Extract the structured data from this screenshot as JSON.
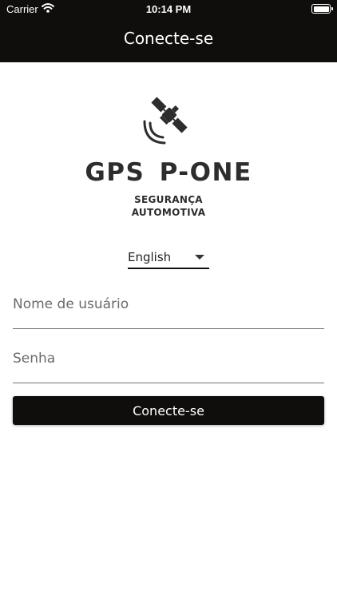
{
  "status_bar": {
    "carrier": "Carrier",
    "time": "10:14 PM"
  },
  "app_bar": {
    "title": "Conecte-se"
  },
  "logo": {
    "brand": "GPS P-ONE",
    "tagline_line1": "SEGURANÇA",
    "tagline_line2": "AUTOMOTIVA",
    "icon": "satellite-icon"
  },
  "language": {
    "selected": "English"
  },
  "form": {
    "username_placeholder": "Nome de usuário",
    "password_placeholder": "Senha",
    "submit_label": "Conecte-se"
  },
  "colors": {
    "bar": "#0f0e0c",
    "brand_text": "#2d2d2d",
    "button": "#0f0e0c"
  }
}
